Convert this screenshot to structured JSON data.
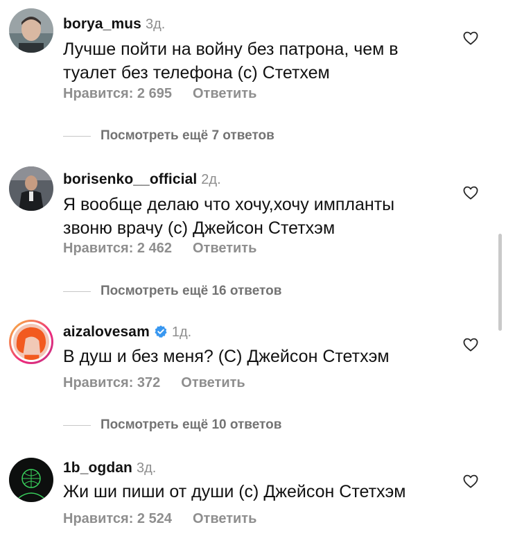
{
  "comments": [
    {
      "username": "borya_mus",
      "time": "3д.",
      "text_lines": [
        "Лучше пойти на войну без патрона, чем в",
        "туалет без телефона (c) Стетхем"
      ],
      "likes": "Нравится: 2 695",
      "reply": "Ответить",
      "more_replies": "Посмотреть ещё 7 ответов"
    },
    {
      "username": "borisenko__official",
      "time": "2д.",
      "text_lines": [
        "Я вообще делаю что хочу,хочу импланты",
        "звоню врачу (с) Джейсон Стетхэм"
      ],
      "likes": "Нравится: 2 462",
      "reply": "Ответить",
      "more_replies": "Посмотреть ещё 16 ответов"
    },
    {
      "username": "aizalovesam",
      "time": "1д.",
      "text_lines": [
        "В душ и без меня? (С) Джейсон Стетхэм"
      ],
      "likes": "Нравится: 372",
      "reply": "Ответить",
      "more_replies": "Посмотреть ещё 10 ответов",
      "verified": true
    },
    {
      "username": "1b_ogdan",
      "time": "3д.",
      "text_lines": [
        "Жи ши пиши от души (с) Джейсон Стетхэм"
      ],
      "likes": "Нравится: 2 524",
      "reply": "Ответить"
    }
  ],
  "colors": {
    "verified": "#3897f0",
    "muted": "#8e8e8e",
    "story_ring": "#ee2a7b"
  },
  "icons": {
    "like": "heart-outline-icon",
    "verified": "verified-badge-icon"
  }
}
